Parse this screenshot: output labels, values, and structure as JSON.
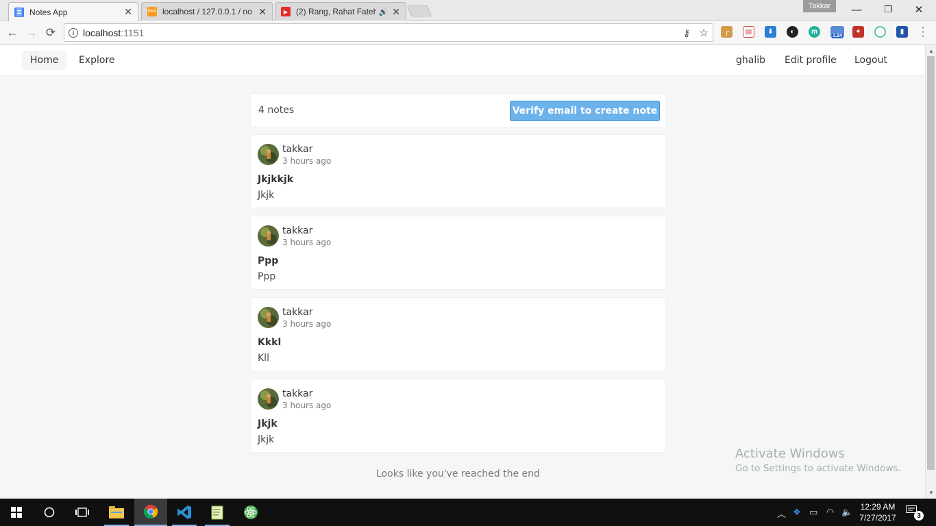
{
  "browser": {
    "tabs": [
      {
        "title": "Notes App",
        "active": true
      },
      {
        "title": "localhost / 127.0.0.1 / no",
        "active": false
      },
      {
        "title": "(2) Rang, Rahat Fateh",
        "active": false
      }
    ],
    "profile_name": "Takkar",
    "url_host": "localhost",
    "url_port": ":1151",
    "extension_badge": "1.24"
  },
  "app": {
    "nav": {
      "home": "Home",
      "explore": "Explore",
      "username": "ghalib",
      "edit_profile": "Edit profile",
      "logout": "Logout"
    },
    "notes_count": "4 notes",
    "verify_button": "Verify email to create note",
    "notes": [
      {
        "author": "takkar",
        "time": "3 hours ago",
        "title": "Jkjkkjk",
        "body": "Jkjk"
      },
      {
        "author": "takkar",
        "time": "3 hours ago",
        "title": "Ppp",
        "body": "Ppp"
      },
      {
        "author": "takkar",
        "time": "3 hours ago",
        "title": "Kkkl",
        "body": "Kll"
      },
      {
        "author": "takkar",
        "time": "3 hours ago",
        "title": "Jkjk",
        "body": "Jkjk"
      }
    ],
    "end_message": "Looks like you've reached the end"
  },
  "watermark": {
    "line1": "Activate Windows",
    "line2": "Go to Settings to activate Windows."
  },
  "taskbar": {
    "time": "12:29 AM",
    "date": "7/27/2017",
    "notification_count": "3"
  },
  "colors": {
    "verify_button": "#6cb2eb",
    "page_background": "#f5f7f7"
  }
}
